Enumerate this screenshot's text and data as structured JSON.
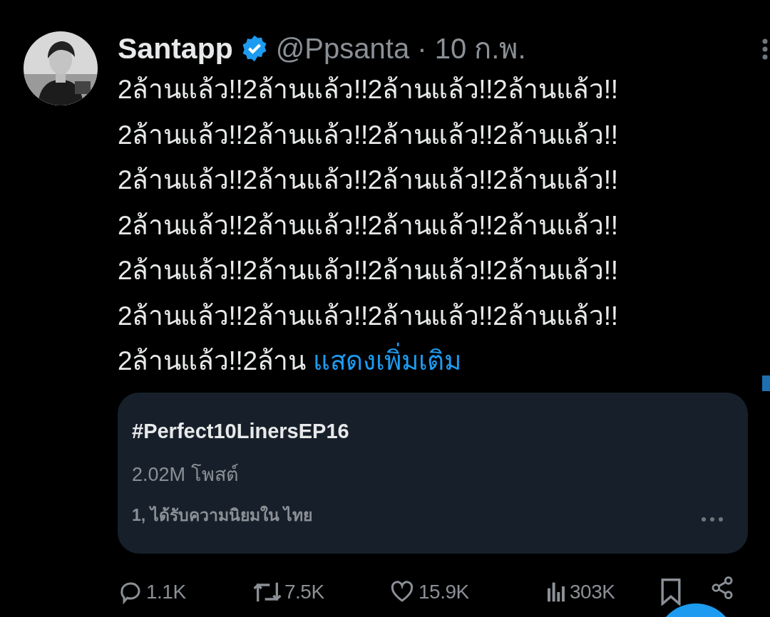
{
  "tweet": {
    "display_name": "Santapp",
    "verified": true,
    "handle": "@Ppsanta",
    "separator": "·",
    "date": "10 ก.พ.",
    "text_lines": [
      "2ล้านแล้ว!!2ล้านแล้ว!!2ล้านแล้ว!!2ล้านแล้ว!!",
      "2ล้านแล้ว!!2ล้านแล้ว!!2ล้านแล้ว!!2ล้านแล้ว!!",
      "2ล้านแล้ว!!2ล้านแล้ว!!2ล้านแล้ว!!2ล้านแล้ว!!",
      "2ล้านแล้ว!!2ล้านแล้ว!!2ล้านแล้ว!!2ล้านแล้ว!!",
      "2ล้านแล้ว!!2ล้านแล้ว!!2ล้านแล้ว!!2ล้านแล้ว!!",
      "2ล้านแล้ว!!2ล้านแล้ว!!2ล้านแล้ว!!2ล้านแล้ว!!",
      "2ล้านแล้ว!!2ล้าน"
    ],
    "show_more": "แสดงเพิ่มเติม",
    "trend_card": {
      "hashtag": "#Perfect10LinersEP16",
      "posts": "2.02M โพสต์",
      "rank": "1, ได้รับความนิยมใน ไทย"
    },
    "actions": [
      {
        "kind": "reply",
        "count": "1.1K"
      },
      {
        "kind": "repost",
        "count": "7.5K"
      },
      {
        "kind": "like",
        "count": "15.9K"
      },
      {
        "kind": "views",
        "count": "303K"
      },
      {
        "kind": "bookmark"
      },
      {
        "kind": "share"
      }
    ]
  }
}
